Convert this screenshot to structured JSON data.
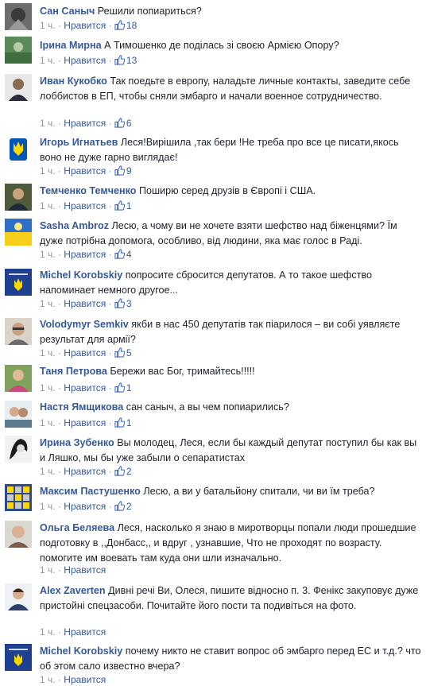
{
  "ui": {
    "time": "1 ч.",
    "sep": "·",
    "like": "Нравится"
  },
  "comments": [
    {
      "name": "Сан Саныч",
      "text": "Решили попиариться?",
      "likes": "18"
    },
    {
      "name": "Ірина Мирна",
      "text": "А Тимошенко де поділась зі своєю Армією Опору?",
      "likes": "13"
    },
    {
      "name": "Иван Кукобко",
      "text": "Так поедьте в европу, наладьте личные контакты, заведите себе лоббистов в ЕП, чтобы сняли эмбарго и начали военное сотрудничество.",
      "likes": "6"
    },
    {
      "name": "Игорь Игнатьев",
      "text": "Леся!Вирішила ,так бери !Не треба про все це писати,якось воно не дуже гарно виглядає!",
      "likes": "9"
    },
    {
      "name": "Темченко Темченко",
      "text": "Поширю серед друзів в Європі і США.",
      "likes": "1"
    },
    {
      "name": "Sasha Ambroz",
      "text": "Лесю, а чому ви не хочете взяти шефство над біженцями? Їм дуже потрібна допомога, особливо, від людини, яка має голос в Раді.",
      "likes": "4"
    },
    {
      "name": "Michel Korobskiy",
      "text": "попросите сбросится депутатов. А то такое шефство напоминает немного другое...",
      "likes": "3"
    },
    {
      "name": "Volodymyr Semkiv",
      "text": "якби в нас 450 депутатів так піарилося – ви собі уявляєте результат для армії?",
      "likes": "5"
    },
    {
      "name": "Таня Петрова",
      "text": "Бережи вас Бог, тримайтесь!!!!!",
      "likes": "1"
    },
    {
      "name": "Настя Ямщикова",
      "text": "сан саныч, а вы чем попиарились?",
      "likes": "1"
    },
    {
      "name": "Ирина Зубенко",
      "text": "Вы молодец, Леся, если бы каждый депутат поступил бы как вы и Ляшко, мы бы уже забыли о сепаратистах",
      "likes": "2"
    },
    {
      "name": "Максим Пастушенко",
      "text": "Лесю, а ви у батальйону спитали, чи ви їм треба?",
      "likes": "2"
    },
    {
      "name": "Ольга Беляева",
      "text": "Леся, насколько я знаю в миротворцы попали люди прошедшие подготовку в ,,Донбасс,, и вдруг , узнавшие, Что не проходят по возрасту. помогите им воевать там куда они шли изначально.",
      "likes": ""
    },
    {
      "name": "Alex Zaverten",
      "text": "Дивні речі Ви, Олеся, пишите відносно п. 3. Фенікс закуповує дуже пристойні спецзасоби. Почитайте його пости та подивіться на фото.",
      "likes": ""
    },
    {
      "name": "Michel Korobskiy",
      "text": "почему никто не ставит вопрос об эмбарго перед ЕС и т.д.? что об этом сало известно вчера?",
      "likes": ""
    }
  ]
}
